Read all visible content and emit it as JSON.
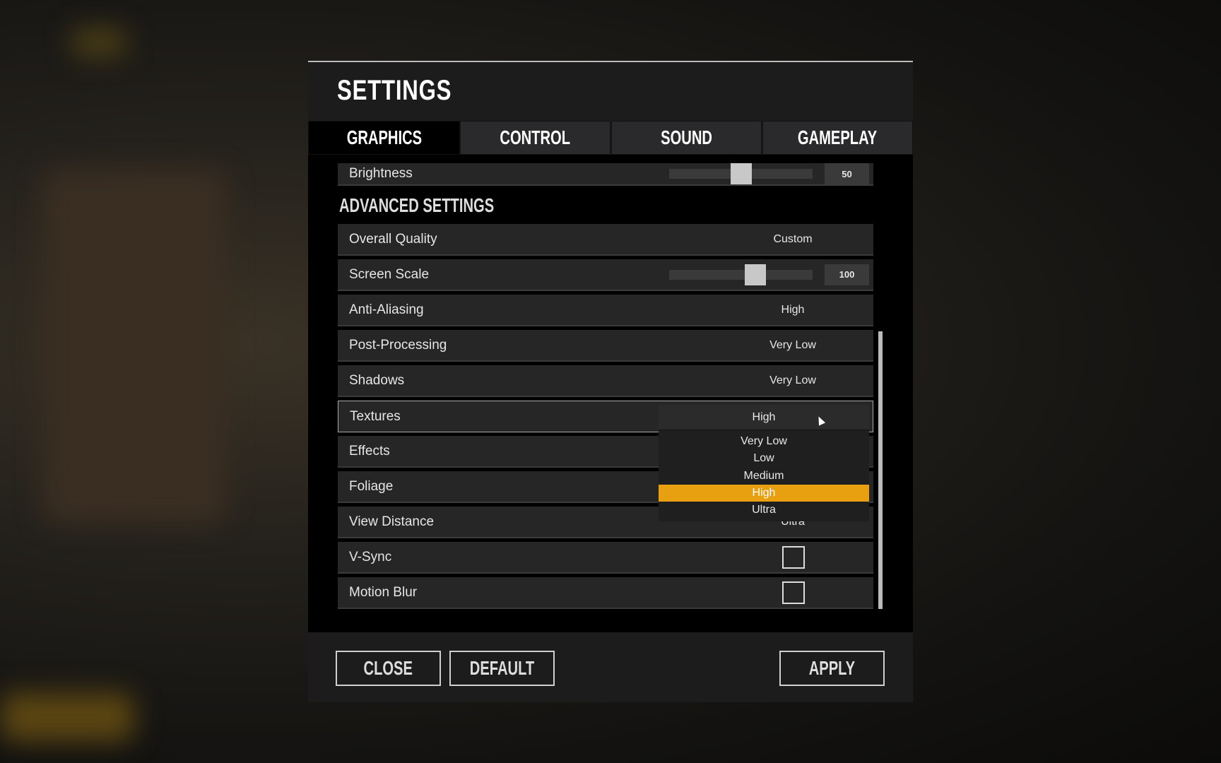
{
  "title": "SETTINGS",
  "tabs": [
    {
      "label": "GRAPHICS",
      "active": true
    },
    {
      "label": "CONTROL"
    },
    {
      "label": "SOUND"
    },
    {
      "label": "GAMEPLAY"
    }
  ],
  "brightness": {
    "label": "Brightness",
    "value": "50",
    "percent": 50
  },
  "advanced_heading": "ADVANCED SETTINGS",
  "rows": [
    {
      "label": "Overall Quality",
      "value": "Custom"
    },
    {
      "label": "Screen Scale",
      "value": "100",
      "slider_percent": 60
    },
    {
      "label": "Anti-Aliasing",
      "value": "High"
    },
    {
      "label": "Post-Processing",
      "value": "Very Low"
    },
    {
      "label": "Shadows",
      "value": "Very Low"
    },
    {
      "label": "Textures",
      "value": "High"
    },
    {
      "label": "Effects",
      "value": ""
    },
    {
      "label": "Foliage",
      "value": ""
    },
    {
      "label": "View Distance",
      "value": "Ultra"
    },
    {
      "label": "V-Sync",
      "checked": false
    },
    {
      "label": "Motion Blur",
      "checked": false
    }
  ],
  "dropdown": {
    "current": "High",
    "options": [
      "Very Low",
      "Low",
      "Medium",
      "High",
      "Ultra"
    ],
    "selected": "High",
    "highlight_color": "#e8a010"
  },
  "buttons": {
    "close": "CLOSE",
    "default": "DEFAULT",
    "apply": "APPLY"
  }
}
